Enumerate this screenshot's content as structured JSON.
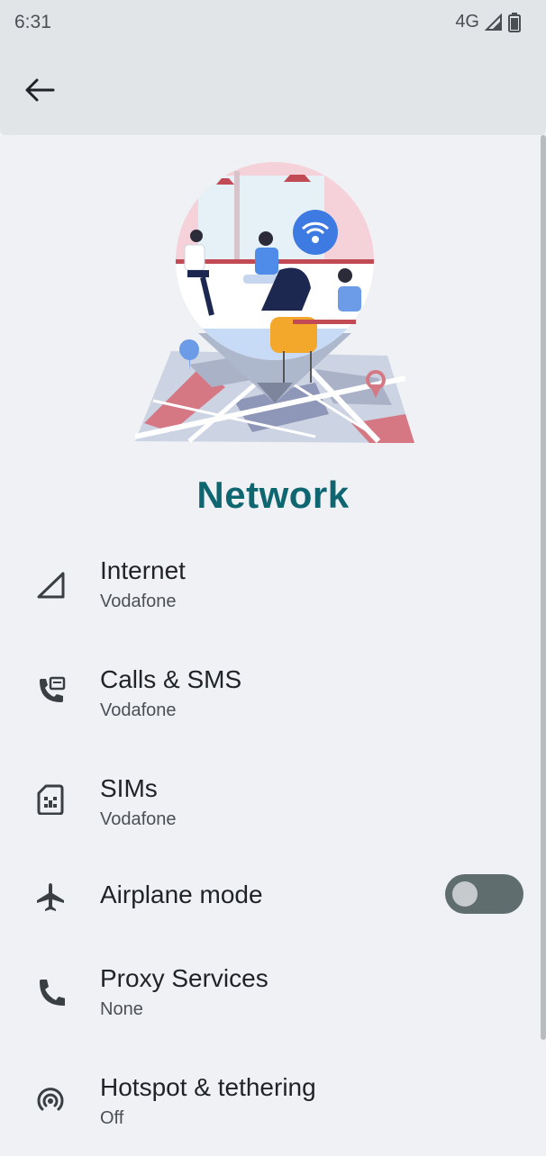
{
  "status_bar": {
    "time": "6:31",
    "network": "4G"
  },
  "app_bar": {
    "back_icon": "arrow-back-icon"
  },
  "page": {
    "title": "Network"
  },
  "items": [
    {
      "icon": "signal-icon",
      "title": "Internet",
      "subtitle": "Vodafone"
    },
    {
      "icon": "calls-sms-icon",
      "title": "Calls & SMS",
      "subtitle": "Vodafone"
    },
    {
      "icon": "sim-card-icon",
      "title": "SIMs",
      "subtitle": "Vodafone"
    },
    {
      "icon": "airplane-icon",
      "title": "Airplane mode",
      "toggle_on": false
    },
    {
      "icon": "phone-icon",
      "title": "Proxy Services",
      "subtitle": "None"
    },
    {
      "icon": "hotspot-icon",
      "title": "Hotspot & tethering",
      "subtitle": "Off"
    }
  ],
  "colors": {
    "accent": "#0e6670",
    "background": "#eff1f4",
    "app_bar": "#e2e5e7",
    "toggle_track_off": "#5f6d6e"
  }
}
